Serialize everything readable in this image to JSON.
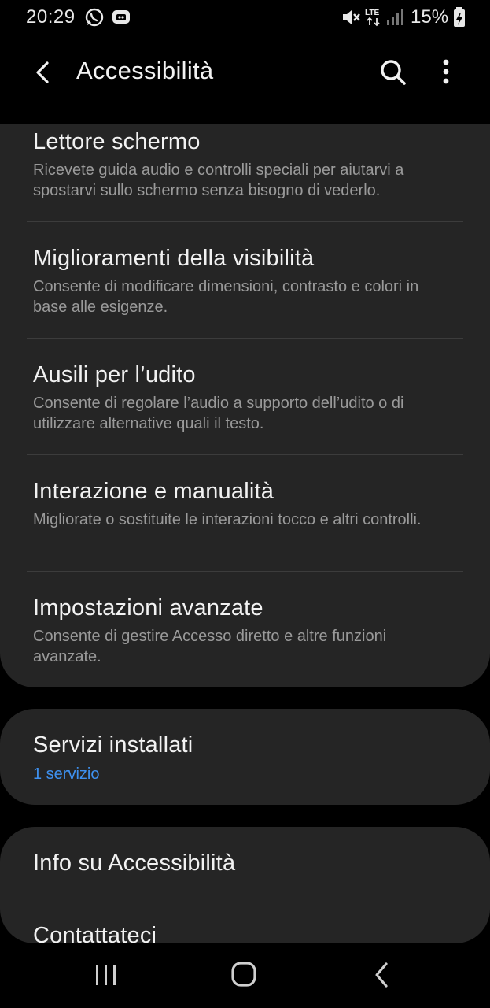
{
  "status_bar": {
    "time": "20:29",
    "network": "LTE",
    "battery": "15%",
    "icons": [
      "whatsapp-icon",
      "messenger-icon",
      "mute-icon",
      "lte-icon",
      "signal-icon",
      "battery-charging-icon"
    ]
  },
  "app_bar": {
    "title": "Accessibilità",
    "icons": [
      "back-arrow-icon",
      "search-icon",
      "more-vert-icon"
    ]
  },
  "main_items": [
    {
      "title": "Lettore schermo",
      "description": "Ricevete guida audio e controlli speciali per aiutarvi a spostarvi sullo schermo senza bisogno di vederlo."
    },
    {
      "title": "Miglioramenti della visibilità",
      "description": "Consente di modificare dimensioni, contrasto e colori in base alle esigenze."
    },
    {
      "title": "Ausili per l’udito",
      "description": "Consente di regolare l’audio a supporto dell’udito o di utilizzare alternative quali il testo."
    },
    {
      "title": "Interazione e manualità",
      "description": "Migliorate o sostituite le interazioni tocco e altri controlli."
    },
    {
      "title": "Impostazioni avanzate",
      "description": "Consente di gestire Accesso diretto e altre funzioni avanzate."
    }
  ],
  "services": {
    "title": "Servizi installati",
    "subtitle": "1 servizio"
  },
  "info_items": [
    {
      "title": "Info su Accessibilità"
    },
    {
      "title": "Contattateci"
    }
  ],
  "nav_bar": {
    "icons": [
      "recent-apps-icon",
      "home-icon",
      "back-icon"
    ]
  },
  "colors": {
    "background": "#000000",
    "card": "#252525",
    "accent_blue": "#3e91f0",
    "secondary_text": "#9a9a9a"
  }
}
